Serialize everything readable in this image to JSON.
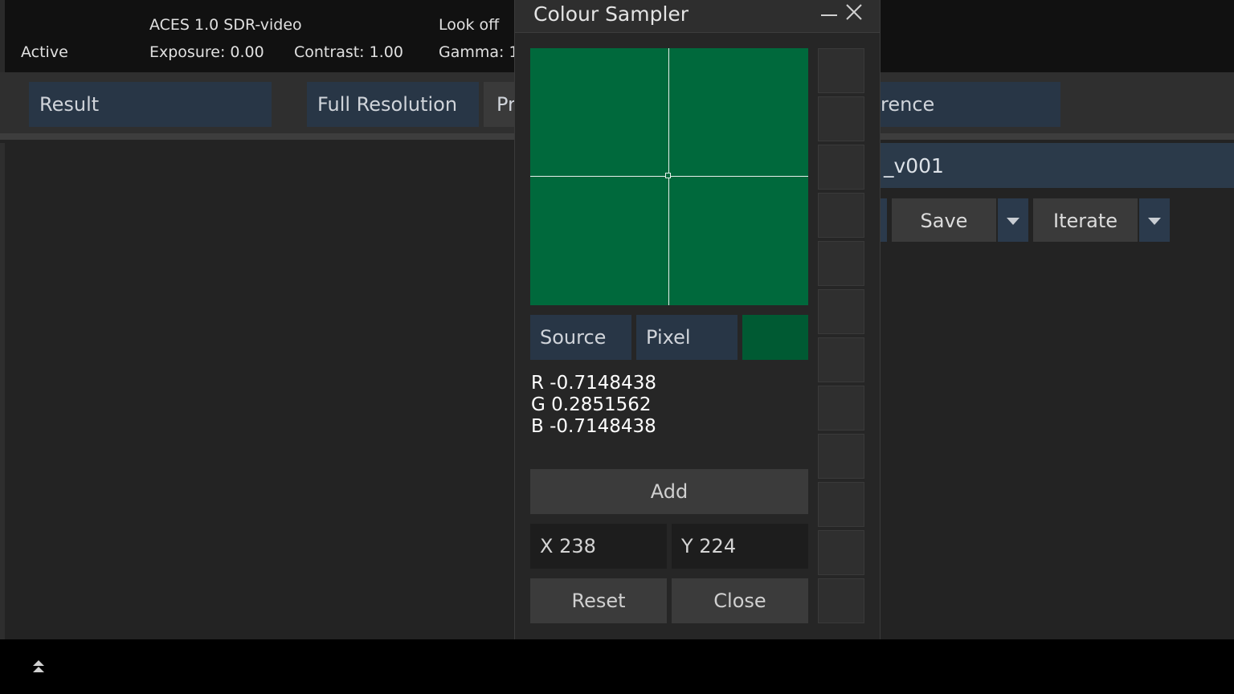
{
  "status": {
    "active": "Active",
    "display": "ACES 1.0 SDR-video",
    "exposure": "Exposure: 0.00",
    "contrast": "Contrast: 1.00",
    "look": "Look off",
    "gamma": "Gamma: 1"
  },
  "toolbar": {
    "result": "Result",
    "full_resolution": "Full Resolution",
    "partial_left": "Pr",
    "partial_right": "rence"
  },
  "output": {
    "name_partial": "_v001",
    "save": "Save",
    "iterate": "Iterate"
  },
  "dialog": {
    "title": "Colour Sampler",
    "modes": {
      "source": "Source",
      "pixel": "Pixel"
    },
    "sample_color": "#005a33",
    "rgb": {
      "r": "R -0.7148438",
      "g": "G 0.2851562",
      "b": "B -0.7148438"
    },
    "add": "Add",
    "x_field": "X 238",
    "y_field": "Y 224",
    "reset": "Reset",
    "close": "Close",
    "slot_count": 12
  },
  "icons": {
    "minimize": "minimize-icon",
    "close": "close-icon",
    "expand": "double-chevron-up-icon",
    "dropdown": "caret-down-icon"
  }
}
